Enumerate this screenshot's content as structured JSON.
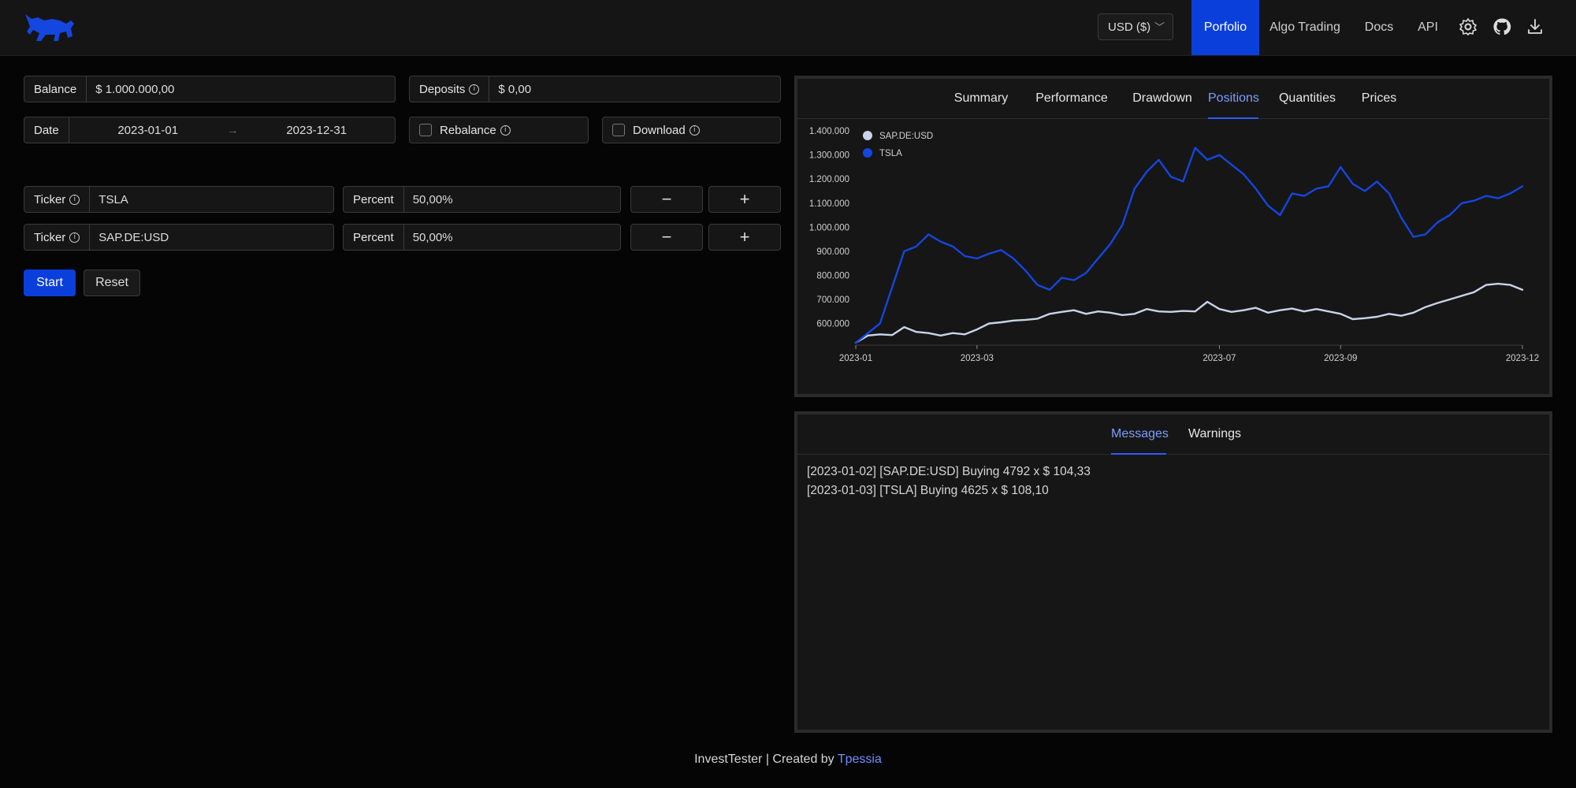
{
  "header": {
    "currency": "USD ($)",
    "nav": [
      "Porfolio",
      "Algo Trading",
      "Docs",
      "API"
    ],
    "active_nav": "Porfolio",
    "icons": [
      "bull-logo",
      "gear-icon",
      "github-icon",
      "download-icon"
    ]
  },
  "form": {
    "balance_label": "Balance",
    "balance_value": "$ 1.000.000,00",
    "deposits_label": "Deposits",
    "deposits_value": "$ 0,00",
    "date_label": "Date",
    "date_start": "2023-01-01",
    "date_arrow": "→",
    "date_end": "2023-12-31",
    "rebalance_label": "Rebalance",
    "download_label": "Download",
    "tickers": [
      {
        "ticker_label": "Ticker",
        "ticker": "TSLA",
        "percent_label": "Percent",
        "percent": "50,00%"
      },
      {
        "ticker_label": "Ticker",
        "ticker": "SAP.DE:USD",
        "percent_label": "Percent",
        "percent": "50,00%"
      }
    ],
    "minus": "−",
    "plus": "+",
    "start_label": "Start",
    "reset_label": "Reset"
  },
  "chart_panel": {
    "tabs": [
      "Summary",
      "Performance",
      "Drawdown",
      "Positions",
      "Quantities",
      "Prices"
    ],
    "active_tab": "Positions"
  },
  "chart_data": {
    "type": "line",
    "x_ticks": [
      "2023-01",
      "2023-03",
      "2023-07",
      "2023-09",
      "2023-12"
    ],
    "x_tick_months": [
      0,
      2,
      6,
      8,
      11
    ],
    "x_range_months": [
      0,
      11
    ],
    "y_ticks": [
      "600.000",
      "700.000",
      "800.000",
      "900.000",
      "1.000.000",
      "1.100.000",
      "1.200.000",
      "1.300.000",
      "1.400.000"
    ],
    "ylim": [
      510000,
      1420000
    ],
    "legend_position": "top-left",
    "series": [
      {
        "name": "SAP.DE:USD",
        "color": "#c9d3ea",
        "x": [
          0,
          0.2,
          0.4,
          0.6,
          0.8,
          1.0,
          1.2,
          1.4,
          1.6,
          1.8,
          2.0,
          2.2,
          2.4,
          2.6,
          2.8,
          3.0,
          3.2,
          3.4,
          3.6,
          3.8,
          4.0,
          4.2,
          4.4,
          4.6,
          4.8,
          5.0,
          5.2,
          5.4,
          5.6,
          5.8,
          6.0,
          6.2,
          6.4,
          6.6,
          6.8,
          7.0,
          7.2,
          7.4,
          7.6,
          7.8,
          8.0,
          8.2,
          8.4,
          8.6,
          8.8,
          9.0,
          9.2,
          9.4,
          9.6,
          9.8,
          10.0,
          10.2,
          10.4,
          10.6,
          10.8,
          11.0
        ],
        "values": [
          520000,
          550000,
          555000,
          552000,
          585000,
          565000,
          560000,
          550000,
          560000,
          555000,
          575000,
          600000,
          605000,
          612000,
          615000,
          620000,
          640000,
          648000,
          655000,
          640000,
          650000,
          645000,
          635000,
          640000,
          660000,
          650000,
          648000,
          652000,
          650000,
          690000,
          660000,
          648000,
          655000,
          665000,
          645000,
          655000,
          662000,
          650000,
          660000,
          650000,
          640000,
          618000,
          622000,
          628000,
          640000,
          632000,
          645000,
          668000,
          685000,
          700000,
          715000,
          730000,
          760000,
          765000,
          760000,
          740000
        ]
      },
      {
        "name": "TSLA",
        "color": "#1446e0",
        "x": [
          0,
          0.2,
          0.4,
          0.6,
          0.8,
          1.0,
          1.2,
          1.4,
          1.6,
          1.8,
          2.0,
          2.2,
          2.4,
          2.6,
          2.8,
          3.0,
          3.2,
          3.4,
          3.6,
          3.8,
          4.0,
          4.2,
          4.4,
          4.6,
          4.8,
          5.0,
          5.2,
          5.4,
          5.6,
          5.8,
          6.0,
          6.2,
          6.4,
          6.6,
          6.8,
          7.0,
          7.2,
          7.4,
          7.6,
          7.8,
          8.0,
          8.2,
          8.4,
          8.6,
          8.8,
          9.0,
          9.2,
          9.4,
          9.6,
          9.8,
          10.0,
          10.2,
          10.4,
          10.6,
          10.8,
          11.0
        ],
        "values": [
          520000,
          560000,
          600000,
          750000,
          900000,
          920000,
          970000,
          940000,
          920000,
          880000,
          870000,
          890000,
          905000,
          870000,
          820000,
          760000,
          740000,
          790000,
          780000,
          810000,
          870000,
          930000,
          1010000,
          1160000,
          1230000,
          1280000,
          1210000,
          1190000,
          1330000,
          1280000,
          1300000,
          1260000,
          1220000,
          1160000,
          1090000,
          1050000,
          1140000,
          1130000,
          1160000,
          1170000,
          1250000,
          1180000,
          1150000,
          1190000,
          1140000,
          1040000,
          960000,
          970000,
          1020000,
          1050000,
          1100000,
          1110000,
          1130000,
          1120000,
          1140000,
          1170000
        ]
      }
    ]
  },
  "messages_panel": {
    "tabs": [
      "Messages",
      "Warnings"
    ],
    "active_tab": "Messages",
    "messages": [
      "[2023-01-02] [SAP.DE:USD] Buying 4792 x $ 104,33",
      "[2023-01-03] [TSLA] Buying 4625 x $ 108,10"
    ]
  },
  "footer": {
    "text": "InvestTester | Created by ",
    "link": "Tpessia"
  }
}
